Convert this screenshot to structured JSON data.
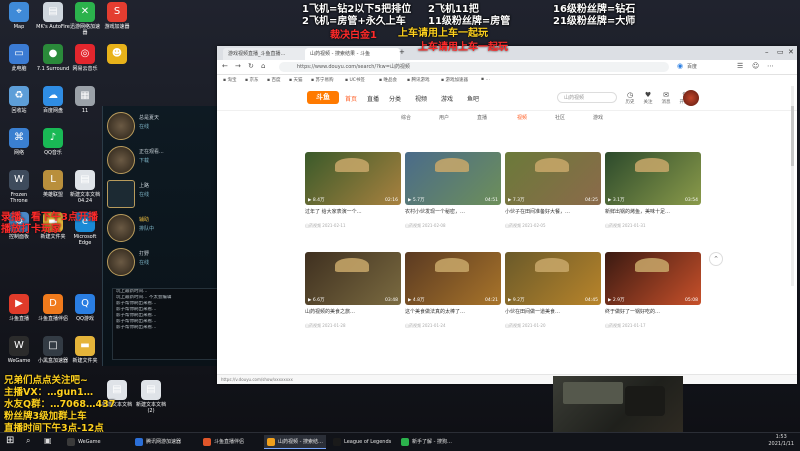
{
  "desktop_icons": [
    {
      "label": "Map",
      "color": "#3f8ad8",
      "glyph": "⌖"
    },
    {
      "label": "MK's AutoFire",
      "color": "#cfd6de",
      "glyph": "▤"
    },
    {
      "label": "迅游网络加速器",
      "color": "#2bb24c",
      "glyph": "✕"
    },
    {
      "label": "游戏加速器",
      "color": "#e43d30",
      "glyph": "S"
    },
    {
      "label": "此电脑",
      "color": "#3b7bd3",
      "glyph": "▭"
    },
    {
      "label": "7.1 Surround",
      "color": "#2a8a3a",
      "glyph": "●"
    },
    {
      "label": "网易云音乐",
      "color": "#e3262d",
      "glyph": "◎"
    },
    {
      "label": "",
      "color": "#e8b21a",
      "glyph": "☻"
    },
    {
      "label": "回收站",
      "color": "#5d9ed8",
      "glyph": "♻"
    },
    {
      "label": "百度网盘",
      "color": "#2f8de4",
      "glyph": "☁"
    },
    {
      "label": "11",
      "color": "#9aa1a8",
      "glyph": "▦"
    },
    {
      "label": "网络",
      "color": "#3a7fd0",
      "glyph": "⌘"
    },
    {
      "label": "QQ音乐",
      "color": "#19b955",
      "glyph": "♪"
    },
    {
      "label": "Frozen Throne",
      "color": "#3e4b5c",
      "glyph": "W"
    },
    {
      "label": "英雄联盟",
      "color": "#b98f3c",
      "glyph": "L"
    },
    {
      "label": "新建文本文档 04.24",
      "color": "#dfe3e8",
      "glyph": "▤"
    },
    {
      "label": "控制面板",
      "color": "#4a88c7",
      "glyph": "⚙"
    },
    {
      "label": "新建文件夹",
      "color": "#e5b43a",
      "glyph": "▬"
    },
    {
      "label": "Microsoft Edge",
      "color": "#1a8ad6",
      "glyph": "e"
    },
    {
      "label": "斗鱼直播",
      "color": "#e03b2a",
      "glyph": "▶"
    },
    {
      "label": "斗鱼直播伴侣",
      "color": "#f07a1c",
      "glyph": "D"
    },
    {
      "label": "QQ游戏",
      "color": "#2a7ee2",
      "glyph": "Q"
    },
    {
      "label": "WeGame",
      "color": "#2b2b2b",
      "glyph": "W"
    },
    {
      "label": "小黑盒加速器",
      "color": "#333b44",
      "glyph": "□"
    },
    {
      "label": "新建文件夹",
      "color": "#e5b43a",
      "glyph": "▬"
    },
    {
      "label": "新建文本文档",
      "color": "#dfe3e8",
      "glyph": "▤"
    },
    {
      "label": "新建文本文档 (2)",
      "color": "#dfe3e8",
      "glyph": "▤"
    }
  ],
  "overlay": {
    "top_left_1": "1飞机=钻2以下5把排位",
    "top_left_2": "2飞机=房管+永久上车",
    "top_mid_1": "2飞机11把",
    "top_mid_2": "11级粉丝牌=房管",
    "top_right_1": "16级粉丝牌=钻石",
    "top_right_2": "21级粉丝牌=大师",
    "caijue": "裁决白金1",
    "shangche": "上车请用上车一起玩",
    "shangche_red": "上车请用上车一起玩",
    "left_red_1": "录播、看下午3点开播",
    "left_red_2": "播放打卡玩家",
    "bottom_1": "兄弟们点点关注吧~",
    "bottom_2": "主播VX：…gun1…",
    "bottom_3": "水友Q群：…7068…437",
    "bottom_4": "粉丝牌3级加群上车",
    "bottom_5": "直播时间下午3点-12点"
  },
  "lol": {
    "friends": [
      {
        "name": "总是夏天",
        "status": "在线"
      },
      {
        "name": "正在观看...",
        "status": "下载"
      },
      {
        "name": "上路",
        "status": "在线"
      },
      {
        "name": "辅助",
        "status": "排队中"
      },
      {
        "name": "打野",
        "status": "在线"
      }
    ],
    "chat_lines": [
      "玩上最新时间…",
      "玩上最新时间… 不太会编辑",
      "影子帮你刷出来看…",
      "影子帮你刷出来看…",
      "影子帮你刷出来看…",
      "影子帮你刷出来看…",
      "影子帮你刷出来看…"
    ]
  },
  "browser": {
    "tabs": [
      {
        "label": "游戏视频直播_斗鱼直播…"
      },
      {
        "label": "山药视频 - 搜索结果 - 斗鱼"
      }
    ],
    "url": "https://www.douyu.com/search/?kw=山药视频",
    "bookmarks": [
      "淘宝",
      "京东",
      "百度",
      "天猫",
      "苏宁易购",
      "UC书签",
      "唯品会",
      "腾讯游戏",
      "游戏加速器",
      "…"
    ],
    "logo": "斗鱼",
    "nav": [
      "首页",
      "直播",
      "分类",
      "视频",
      "游戏",
      "鱼吧"
    ],
    "search_placeholder": "山药视频",
    "header_icons": [
      {
        "glyph": "◷",
        "label": "历史"
      },
      {
        "glyph": "♥",
        "label": "关注"
      },
      {
        "glyph": "✉",
        "label": "消息"
      },
      {
        "glyph": "⇪",
        "label": "开播"
      }
    ],
    "filter_tabs": [
      "综合",
      "用户",
      "直播",
      "视频",
      "社区",
      "游戏"
    ],
    "active_filter": "视频",
    "videos": [
      {
        "title": "过年了 给大家表演一个…",
        "author": "山药视频",
        "plays": "8.4万",
        "dur": "02:16",
        "date": "2021-02-11",
        "colors": [
          "#3a5a2a",
          "#a8813f"
        ]
      },
      {
        "title": "农村小伙发现一个秘密，…",
        "author": "山药视频",
        "plays": "5.7万",
        "dur": "04:51",
        "date": "2021-02-08",
        "colors": [
          "#4a6b8a",
          "#6d8f5a"
        ]
      },
      {
        "title": "小伙子在田间准备好大餐，…",
        "author": "山药视频",
        "plays": "7.3万",
        "dur": "04:25",
        "date": "2021-02-05",
        "colors": [
          "#6b7a3a",
          "#8b6a4a"
        ]
      },
      {
        "title": "新鲜出锅的烤鱼，美味十足…",
        "author": "山药视频",
        "plays": "3.1万",
        "dur": "03:54",
        "date": "2021-01-31",
        "colors": [
          "#2c4a2c",
          "#8a9a4a"
        ]
      },
      {
        "title": "山药视频的美食之旅…",
        "author": "山药视频",
        "plays": "6.6万",
        "dur": "03:48",
        "date": "2021-01-28",
        "colors": [
          "#3f3020",
          "#7a6a40"
        ]
      },
      {
        "title": "这个美食做法真的太棒了…",
        "author": "山药视频",
        "plays": "4.8万",
        "dur": "04:21",
        "date": "2021-01-24",
        "colors": [
          "#5a3a22",
          "#a8742a"
        ]
      },
      {
        "title": "小伙在田间做一道美食…",
        "author": "山药视频",
        "plays": "9.2万",
        "dur": "04:45",
        "date": "2021-01-20",
        "colors": [
          "#6a5a2a",
          "#b8842a"
        ]
      },
      {
        "title": "终于做好了一锅好吃的…",
        "author": "山药视频",
        "plays": "2.9万",
        "dur": "05:08",
        "date": "2021-01-17",
        "colors": [
          "#3a1a12",
          "#c8502a"
        ]
      }
    ],
    "status_url": "https://v.douyu.com/show/xxxxxxxx"
  },
  "taskbar": {
    "items": [
      {
        "label": "WeGame",
        "color": "#3a3a3a",
        "active": false
      },
      {
        "label": "腾讯网游加速器",
        "color": "#2b6fd8",
        "active": false
      },
      {
        "label": "斗鱼直播伴侣",
        "color": "#e0562a",
        "active": false
      },
      {
        "label": "山药视频 - 搜索结…",
        "color": "#f0a01c",
        "active": true
      },
      {
        "label": "League of Legends",
        "color": "#1a1a1a",
        "active": false
      },
      {
        "label": "新手了解 - 搜狗…",
        "color": "#2bb24c",
        "active": false
      }
    ],
    "time": "1:53",
    "date": "2021/1/11"
  }
}
